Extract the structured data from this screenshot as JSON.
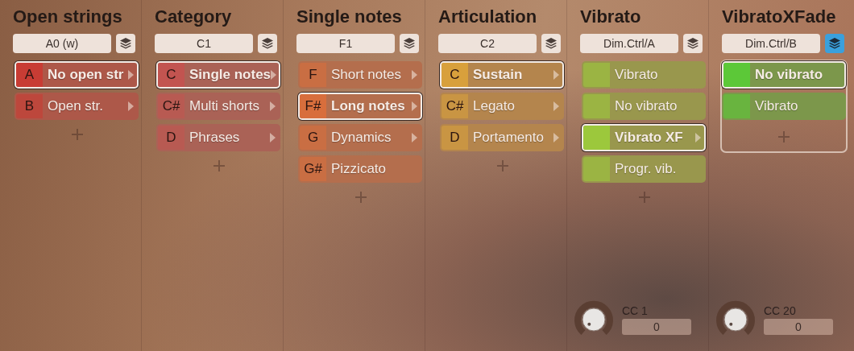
{
  "columns": [
    {
      "title": "Open strings",
      "key_field": "A0 (w)",
      "layers_active": false,
      "color": "#c83c34",
      "grouped": false,
      "items": [
        {
          "key": "A",
          "label": "No open str",
          "selected": true,
          "submenu": true
        },
        {
          "key": "B",
          "label": "Open str.",
          "selected": false,
          "submenu": true
        }
      ]
    },
    {
      "title": "Category",
      "key_field": "C1",
      "layers_active": false,
      "color": "#c25450",
      "grouped": false,
      "items": [
        {
          "key": "C",
          "label": "Single notes",
          "selected": true,
          "submenu": true
        },
        {
          "key": "C#",
          "label": "Multi shorts",
          "selected": false,
          "submenu": true
        },
        {
          "key": "D",
          "label": "Phrases",
          "selected": false,
          "submenu": true
        }
      ]
    },
    {
      "title": "Single notes",
      "key_field": "F1",
      "layers_active": false,
      "color": "#d86e3c",
      "grouped": false,
      "items": [
        {
          "key": "F",
          "label": "Short notes",
          "selected": false,
          "submenu": true
        },
        {
          "key": "F#",
          "label": "Long notes",
          "selected": true,
          "submenu": true
        },
        {
          "key": "G",
          "label": "Dynamics",
          "selected": false,
          "submenu": true
        },
        {
          "key": "G#",
          "label": "Pizzicato",
          "selected": false,
          "submenu": false
        }
      ]
    },
    {
      "title": "Articulation",
      "key_field": "C2",
      "layers_active": false,
      "color": "#d8a03c",
      "grouped": false,
      "items": [
        {
          "key": "C",
          "label": "Sustain",
          "selected": true,
          "submenu": true
        },
        {
          "key": "C#",
          "label": "Legato",
          "selected": false,
          "submenu": true
        },
        {
          "key": "D",
          "label": "Portamento",
          "selected": false,
          "submenu": true
        }
      ]
    },
    {
      "title": "Vibrato",
      "key_field": "Dim.Ctrl/A",
      "layers_active": false,
      "color": "#9cc83c",
      "grouped": false,
      "items": [
        {
          "label": "Vibrato",
          "selected": false,
          "submenu": false
        },
        {
          "label": "No vibrato",
          "selected": false,
          "submenu": false
        },
        {
          "label": "Vibrato XF",
          "selected": true,
          "submenu": true
        },
        {
          "label": "Progr. vib.",
          "selected": false,
          "submenu": false
        }
      ],
      "knob": {
        "label": "CC 1",
        "value": "0"
      }
    },
    {
      "title": "VibratoXFade",
      "key_field": "Dim.Ctrl/B",
      "layers_active": true,
      "color": "#5cc838",
      "grouped": true,
      "items": [
        {
          "label": "No vibrato",
          "selected": true,
          "submenu": false
        },
        {
          "label": "Vibrato",
          "selected": false,
          "submenu": false
        }
      ],
      "knob": {
        "label": "CC 20",
        "value": "0"
      }
    }
  ]
}
